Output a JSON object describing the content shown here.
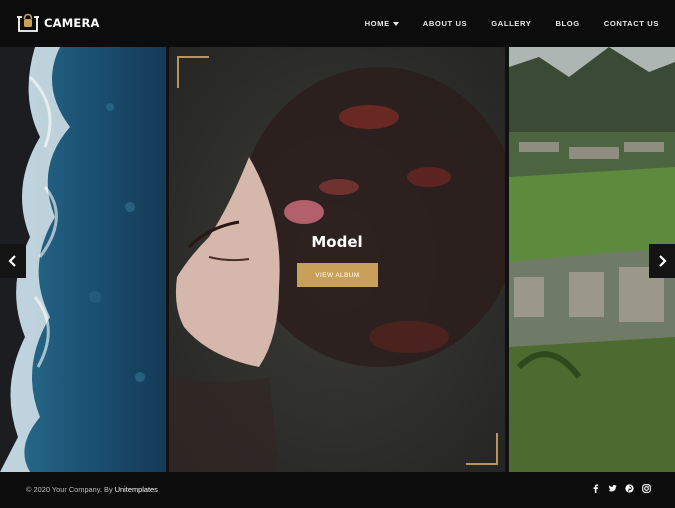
{
  "brand": {
    "name": "CAMERA",
    "logo_icon": "camera-bag-icon"
  },
  "nav": {
    "items": [
      {
        "label": "HOME",
        "has_dropdown": true
      },
      {
        "label": "ABOUT US"
      },
      {
        "label": "GALLERY"
      },
      {
        "label": "BLOG"
      },
      {
        "label": "CONTACT US"
      }
    ]
  },
  "slider": {
    "active_title": "Model",
    "button_label": "VIEW ALBUM",
    "prev_icon": "chevron-left-icon",
    "next_icon": "chevron-right-icon",
    "slides": [
      {
        "scene": "ocean-coastline"
      },
      {
        "scene": "woman-with-flowers"
      },
      {
        "scene": "mountain-ruins"
      }
    ]
  },
  "footer": {
    "copyright": "© 2020 Your Company. By ",
    "credit": "Unitemplates",
    "social_icons": [
      "facebook-icon",
      "twitter-icon",
      "pinterest-icon",
      "instagram-icon"
    ]
  },
  "colors": {
    "accent": "#c9a05a",
    "header_bg": "#0c0c0c",
    "text_light": "#e8e8e8"
  }
}
